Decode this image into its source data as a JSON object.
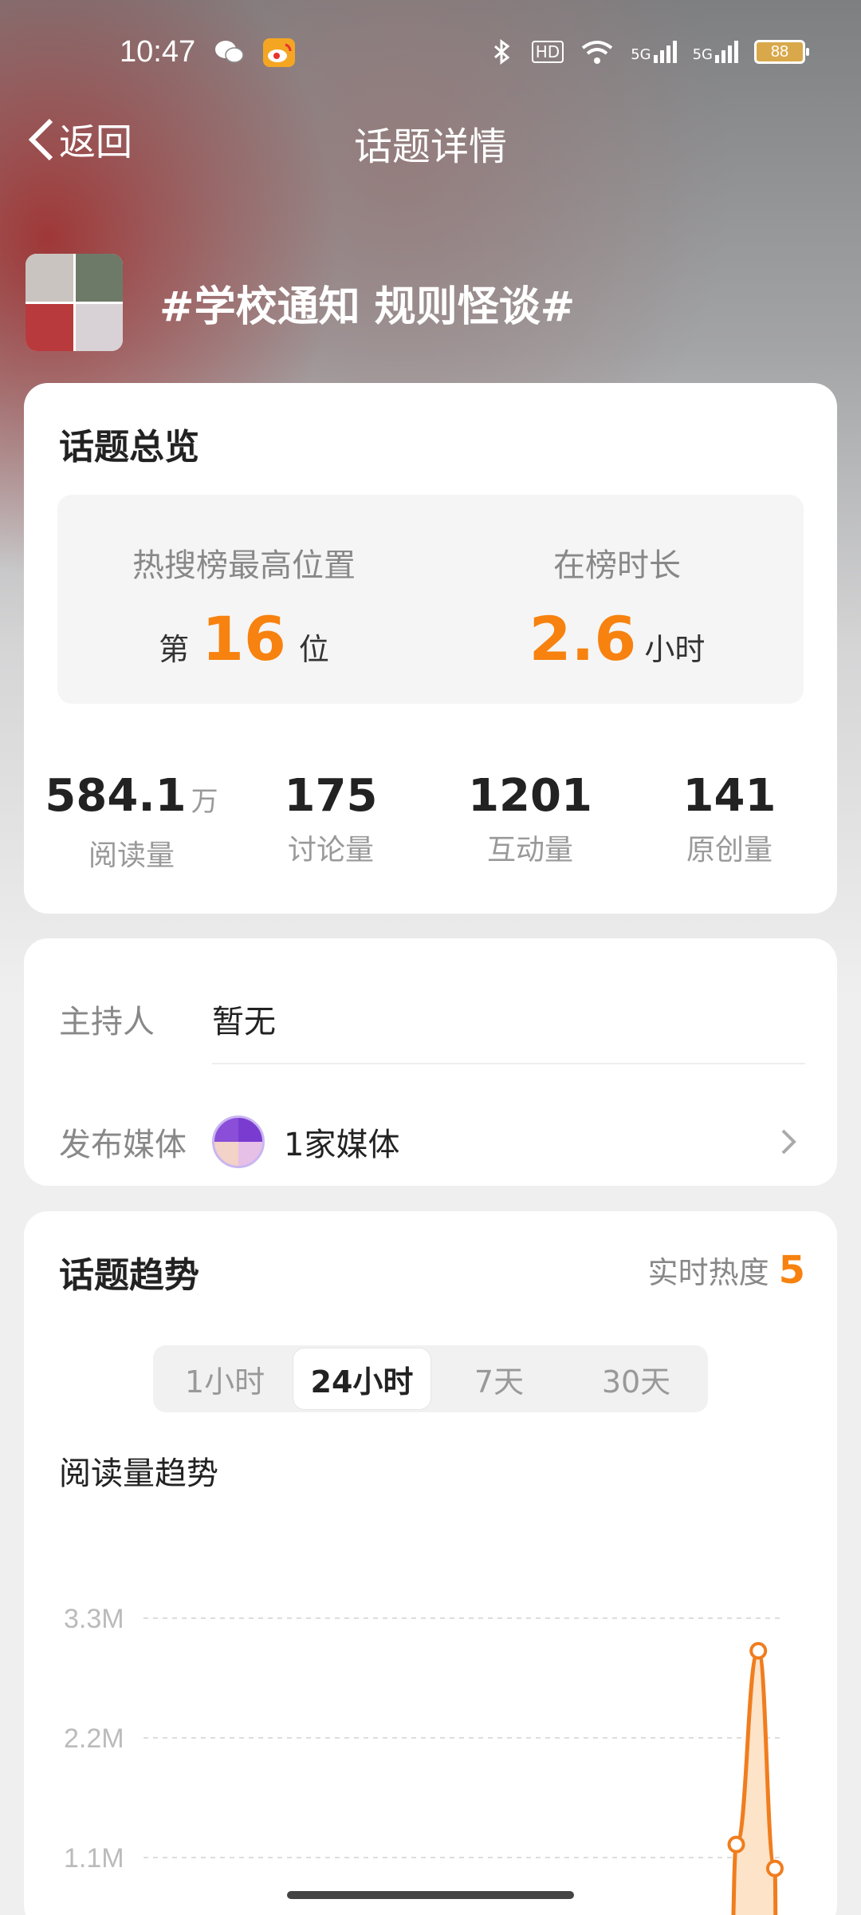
{
  "status_bar": {
    "time": "10:47",
    "battery": "88",
    "network1": "5G",
    "network2": "5G",
    "hd": "HD"
  },
  "nav": {
    "back_label": "返回",
    "title": "话题详情"
  },
  "topic": {
    "title": "#学校通知 规则怪谈#"
  },
  "overview": {
    "title": "话题总览",
    "rank_label": "热搜榜最高位置",
    "rank_prefix": "第",
    "rank_value": "16",
    "rank_suffix": "位",
    "duration_label": "在榜时长",
    "duration_value": "2.6",
    "duration_unit": "小时",
    "stats": [
      {
        "value": "584.1",
        "unit": "万",
        "label": "阅读量"
      },
      {
        "value": "175",
        "unit": "",
        "label": "讨论量"
      },
      {
        "value": "1201",
        "unit": "",
        "label": "互动量"
      },
      {
        "value": "141",
        "unit": "",
        "label": "原创量"
      }
    ]
  },
  "info": {
    "host_label": "主持人",
    "host_value": "暂无",
    "media_label": "发布媒体",
    "media_value": "1家媒体"
  },
  "trend": {
    "title": "话题趋势",
    "hot_label": "实时热度",
    "hot_value": "5",
    "tabs": [
      "1小时",
      "24小时",
      "7天",
      "30天"
    ],
    "active_tab": "24小时",
    "chart_title": "阅读量趋势"
  },
  "colors": {
    "accent": "#f7820f",
    "line": "#f07d1e",
    "fill": "#fde3c8"
  },
  "chart_data": {
    "type": "area",
    "ytick_labels": [
      "3.3M",
      "2.2M",
      "1.1M"
    ],
    "yticks": [
      3.3,
      2.2,
      1.1
    ],
    "ylim": [
      0,
      3.6
    ],
    "xlim": [
      0,
      24
    ],
    "points": [
      {
        "x": 21.3,
        "y": 0.0
      },
      {
        "x": 21.5,
        "y": 1.22
      },
      {
        "x": 22.3,
        "y": 3.0
      },
      {
        "x": 22.9,
        "y": 1.0
      },
      {
        "x": 22.95,
        "y": 0.0
      }
    ],
    "markers": [
      1,
      2,
      3
    ],
    "grid": true
  }
}
